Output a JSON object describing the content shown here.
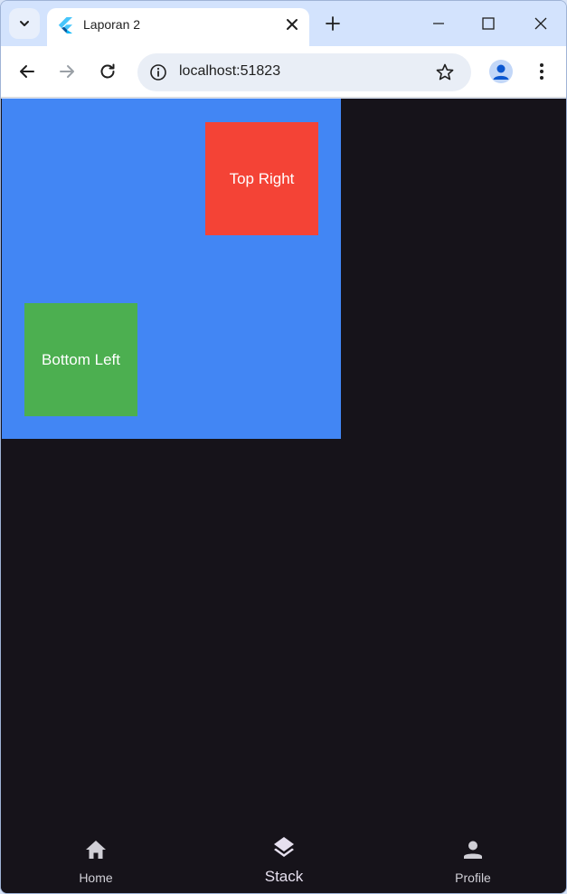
{
  "browser": {
    "tab": {
      "title": "Laporan 2"
    },
    "address_bar": {
      "url": "localhost:51823"
    }
  },
  "page": {
    "squares": {
      "top_right_label": "Top Right",
      "bottom_left_label": "Bottom Left"
    },
    "bottom_nav": {
      "items": [
        {
          "label": "Home",
          "icon": "home-icon"
        },
        {
          "label": "Stack",
          "icon": "layers-icon",
          "selected": true
        },
        {
          "label": "Profile",
          "icon": "person-icon"
        }
      ]
    }
  },
  "colors": {
    "stack_background": "#4286f4",
    "top_right_square": "#f44336",
    "bottom_left_square": "#4caf50",
    "page_background": "#16131a",
    "tab_strip": "#d3e3fd"
  }
}
